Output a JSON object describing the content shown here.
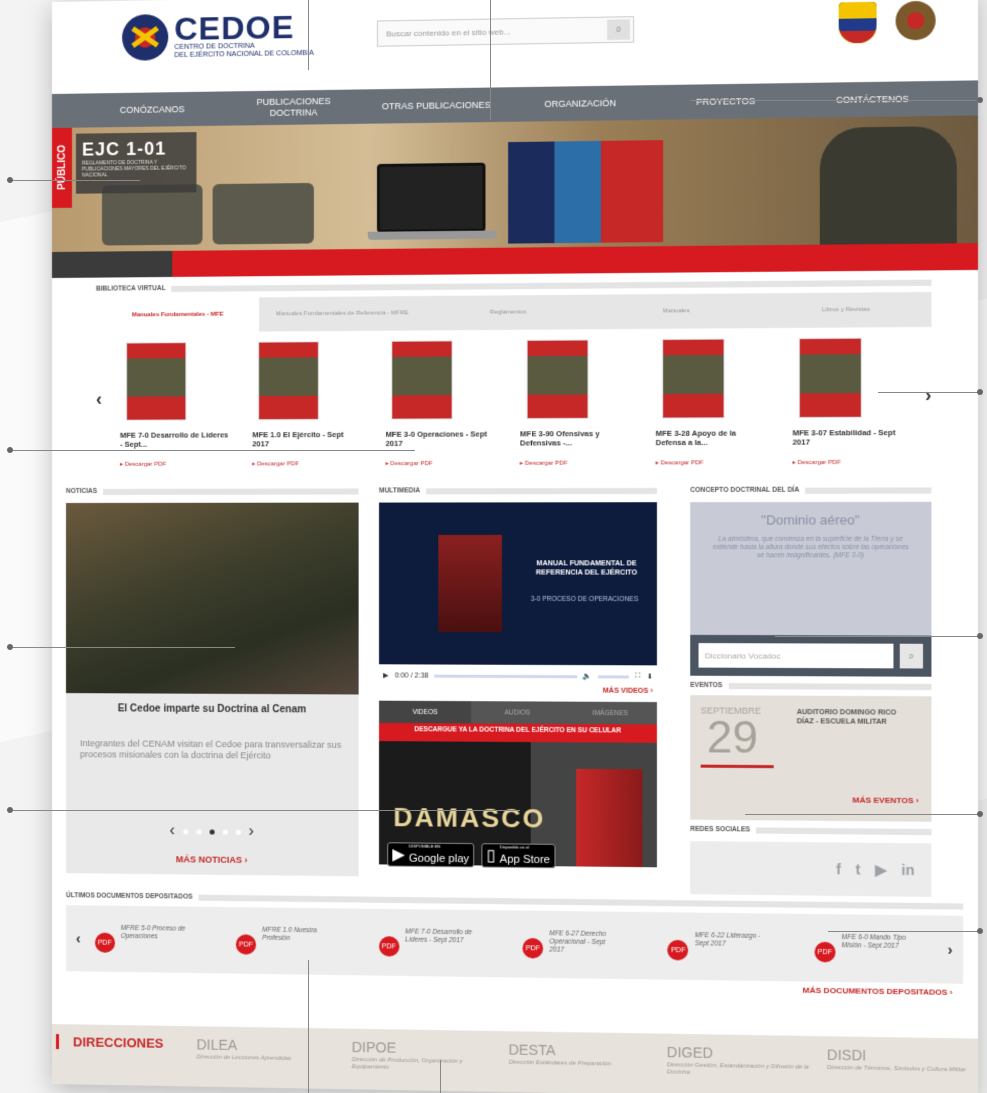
{
  "header": {
    "logo_title": "CEDOE",
    "logo_sub": "CENTRO DE DOCTRINA",
    "logo_sub2": "DEL EJÉRCITO NACIONAL DE COLOMBIA",
    "search_placeholder": "Buscar contenido en el sitio web...",
    "search_icon": "search-icon"
  },
  "nav": {
    "items": [
      {
        "label": "CONÓZCANOS"
      },
      {
        "label": "PUBLICACIONES DOCTRINA"
      },
      {
        "label": "OTRAS PUBLICACIONES"
      },
      {
        "label": "ORGANIZACIÓN"
      },
      {
        "label": "PROYECTOS"
      },
      {
        "label": "CONTÁCTENOS"
      }
    ]
  },
  "hero": {
    "tag": "PÚBLICO",
    "code": "EJC 1-01",
    "desc": "REGLAMENTO DE DOCTRINA Y PUBLICACIONES MAYORES DEL EJÉRCITO NACIONAL"
  },
  "biblioteca": {
    "title": "BIBLIOTECA VIRTUAL",
    "tabs": [
      {
        "label": "Manuales Fundamentales - MFE"
      },
      {
        "label": "Manuales Fundamentales de Referencia - MFRE"
      },
      {
        "label": "Reglamentos"
      },
      {
        "label": "Manuales"
      },
      {
        "label": "Libros y Revistas"
      }
    ],
    "books": [
      {
        "title": "MFE 7-0 Desarrollo de Líderes - Sept...",
        "link": "Descargar PDF"
      },
      {
        "title": "MFE 1.0 El Ejército - Sept 2017",
        "link": "Descargar PDF"
      },
      {
        "title": "MFE 3-0 Operaciones - Sept 2017",
        "link": "Descargar PDF"
      },
      {
        "title": "MFE 3-90 Ofensivas y Defensivas -...",
        "link": "Descargar PDF"
      },
      {
        "title": "MFE 3-28 Apoyo de la Defensa a la...",
        "link": "Descargar PDF"
      },
      {
        "title": "MFE 3-07 Estabilidad - Sept 2017",
        "link": "Descargar PDF"
      }
    ]
  },
  "noticias": {
    "title": "NOTICIAS",
    "headline": "El Cedoe imparte su Doctrina al Cenam",
    "text": "Integrantes del CENAM visitan el Cedoe para transversalizar sus procesos misionales con la doctrina del Ejército",
    "more": "MÁS NOTICIAS ›"
  },
  "multimedia": {
    "title": "MULTIMEDIA",
    "video_title": "MANUAL FUNDAMENTAL DE REFERENCIA DEL EJÉRCITO",
    "video_sub": "3-0 PROCESO DE OPERACIONES",
    "time": "0:00 / 2:38",
    "more": "MÁS VIDEOS ›",
    "tabs": [
      "VIDEOS",
      "AUDIOS",
      "IMÁGENES"
    ],
    "banner_head": "DESCARGUE YA LA DOCTRINA DEL EJÉRCITO EN SU CELULAR",
    "banner_word": "DAMASCO",
    "store1_small": "DISPONIBLE EN",
    "store1": "Google play",
    "store2_small": "Disponible en el",
    "store2": "App Store"
  },
  "concepto": {
    "title": "CONCEPTO DOCTRINAL DEL DÍA",
    "term": "\"Dominio aéreo\"",
    "text": "La atmósfera, que comienza en la superficie de la Tierra y se extiende hasta la altura donde sus efectos sobre las operaciones se hacen insignificantes. (MFE 3-0)",
    "dict_placeholder": "Diccionario Vocadoc"
  },
  "eventos": {
    "title": "EVENTOS",
    "month": "SEPTIEMBRE",
    "day": "29",
    "desc": "AUDITORIO DOMINGO RICO DÍAZ - ESCUELA MILITAR",
    "more": "MÁS EVENTOS ›"
  },
  "redes": {
    "title": "REDES SOCIALES",
    "icons": [
      "f",
      "t",
      "▶",
      "in"
    ]
  },
  "docs": {
    "title": "ÚLTIMOS DOCUMENTOS DEPOSITADOS",
    "items": [
      {
        "name": "MFRE 5-0 Proceso de Operaciones"
      },
      {
        "name": "MFRE 1.0 Nuestra Profesión"
      },
      {
        "name": "MFE 7-0 Desarrollo de Líderes - Sept 2017"
      },
      {
        "name": "MFE 6-27 Derecho Operacional - Sept 2017"
      },
      {
        "name": "MFE 6-22 Liderazgo - Sept 2017"
      },
      {
        "name": "MFE 6-0 Mando Tipo Misión - Sept 2017"
      }
    ],
    "more": "MÁS DOCUMENTOS DEPOSITADOS ›"
  },
  "direcciones": {
    "label": "DIRECCIONES",
    "items": [
      {
        "code": "DILEA",
        "name": "Dirección de Lecciones Aprendidas"
      },
      {
        "code": "DIPOE",
        "name": "Dirección de Producción, Organización y Equipamiento"
      },
      {
        "code": "DESTA",
        "name": "Dirección Estándares de Preparación"
      },
      {
        "code": "DIGED",
        "name": "Dirección Gestión, Estandarización y Difusión de la Doctrina"
      },
      {
        "code": "DISDI",
        "name": "Dirección de Términos, Símbolos y Cultura Militar"
      }
    ]
  },
  "colors": {
    "accent": "#d71920",
    "nav": "#6a7078",
    "brand": "#1e2f6b"
  }
}
